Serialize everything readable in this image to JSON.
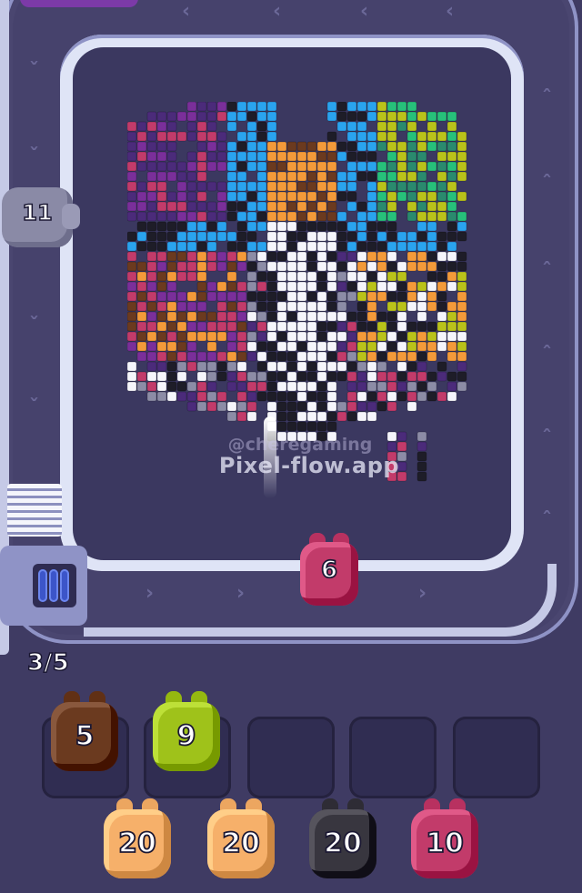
{
  "conveyor": {
    "active_shooter": {
      "count": "6",
      "color": "#c23b6a"
    },
    "waiting_shooter": {
      "count": "11",
      "color": "#8a8aa6"
    }
  },
  "queue_counter": "3/5",
  "watermark": {
    "handle": "@cheregaming",
    "site": "Pixel-flow.app"
  },
  "slots": [
    {
      "filled": true,
      "count": "5",
      "color": "#6b3a1f"
    },
    {
      "filled": true,
      "count": "9",
      "color": "#9fc21a"
    },
    {
      "filled": false
    },
    {
      "filled": false
    },
    {
      "filled": false
    }
  ],
  "shooters": [
    {
      "count": "20",
      "color": "#f6b06a"
    },
    {
      "count": "20",
      "color": "#f6b06a"
    },
    {
      "count": "20",
      "color": "#38363f"
    },
    {
      "count": "10",
      "color": "#c23b6a"
    }
  ],
  "palette": [
    "#4b2b7a",
    "#7a2f9a",
    "#c23b6a",
    "#f39a3a",
    "#2aa3ee",
    "#27c07a",
    "#1e1d28",
    "#f5f5fb",
    "#8c8ca6",
    "#b9c21a",
    "#6b3a1f",
    "#2a8a6e"
  ]
}
